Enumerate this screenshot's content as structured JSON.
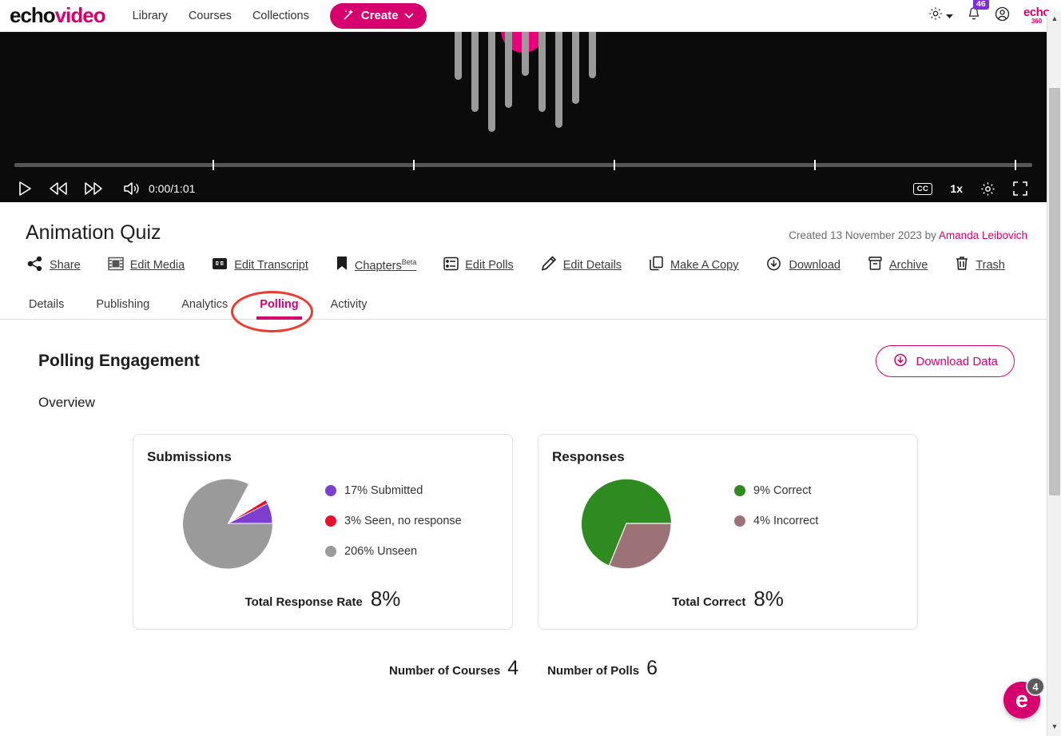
{
  "header": {
    "logo_echo": "echo",
    "logo_video": "video",
    "nav": [
      {
        "label": "Library"
      },
      {
        "label": "Courses"
      },
      {
        "label": "Collections"
      }
    ],
    "create_label": "Create",
    "create_icon": "magic-wand-icon",
    "settings_icon": "gear-icon",
    "notifications_icon": "bell-icon",
    "notifications_count": "46",
    "account_icon": "user-account-icon",
    "brand_mark_name": "echo",
    "brand_mark_number": "360"
  },
  "player": {
    "play_icon": "play-icon",
    "rewind_icon": "rewind-icon",
    "forward_icon": "fast-forward-icon",
    "volume_icon": "volume-icon",
    "time_display": "0:00/1:01",
    "cc_label": "CC",
    "speed_label": "1x",
    "settings_icon": "gear-icon",
    "fullscreen_icon": "fullscreen-icon",
    "marker_positions": [
      20,
      40,
      60,
      80,
      100
    ]
  },
  "asset": {
    "title": "Animation Quiz",
    "created_prefix": "Created 13 November 2023 by ",
    "created_author": "Amanda Leibovich"
  },
  "toolbar": [
    {
      "label": "Share",
      "icon": "share-icon"
    },
    {
      "label": "Edit Media",
      "icon": "film-strip-icon"
    },
    {
      "label": "Edit Transcript",
      "icon": "quote-icon"
    },
    {
      "label": "Chapters",
      "sup": "Beta",
      "icon": "bookmark-icon"
    },
    {
      "label": "Edit Polls",
      "icon": "list-icon"
    },
    {
      "label": "Edit Details",
      "icon": "pencil-icon"
    },
    {
      "label": "Make A Copy",
      "icon": "copy-icon"
    },
    {
      "label": "Download",
      "icon": "cloud-download-icon"
    },
    {
      "label": "Archive",
      "icon": "archive-box-icon"
    },
    {
      "label": "Trash",
      "icon": "trash-icon"
    }
  ],
  "tabs": [
    {
      "label": "Details",
      "active": false
    },
    {
      "label": "Publishing",
      "active": false
    },
    {
      "label": "Analytics",
      "active": false
    },
    {
      "label": "Polling",
      "active": true
    },
    {
      "label": "Activity",
      "active": false
    }
  ],
  "main": {
    "section_title": "Polling Engagement",
    "download_label": "Download Data",
    "download_icon": "cloud-download-icon",
    "overview_label": "Overview"
  },
  "chart_data": [
    {
      "type": "pie",
      "title": "Submissions",
      "categories": [
        "Submitted",
        "Seen, no response",
        "Unseen"
      ],
      "labels": [
        "17% Submitted",
        "3% Seen, no response",
        "206% Unseen"
      ],
      "values": [
        17,
        3,
        206
      ],
      "colors": [
        "#7e3fd0",
        "#e8102a",
        "#9a9a9a"
      ],
      "legend_position": "right",
      "footer_label": "Total Response Rate",
      "footer_value": "8%"
    },
    {
      "type": "pie",
      "title": "Responses",
      "categories": [
        "Correct",
        "Incorrect"
      ],
      "labels": [
        "9% Correct",
        "4% Incorrect"
      ],
      "values": [
        9,
        4
      ],
      "colors": [
        "#2e8b20",
        "#9c7277"
      ],
      "legend_position": "right",
      "footer_label": "Total Correct",
      "footer_value": "8%"
    }
  ],
  "stats": [
    {
      "label": "Number of Courses",
      "value": "4"
    },
    {
      "label": "Number of Polls",
      "value": "6"
    }
  ],
  "help_widget": {
    "glyph": "e",
    "badge_count": "4"
  },
  "colors": {
    "brand_pink": "#d6006e",
    "annotation_red": "#ef3b2d",
    "badge_purple": "#7e2ed6"
  }
}
